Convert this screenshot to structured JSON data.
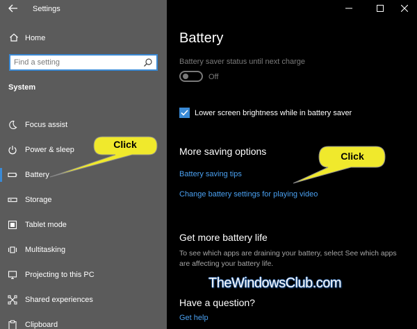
{
  "window": {
    "app_title": "Settings",
    "controls": {
      "minimize": "—",
      "maximize": "☐",
      "close": "✕"
    }
  },
  "sidebar": {
    "home_label": "Home",
    "search": {
      "placeholder": "Find a setting",
      "value": ""
    },
    "section_label": "System",
    "items": [
      {
        "label": "Focus assist",
        "icon": "moon-icon"
      },
      {
        "label": "Power & sleep",
        "icon": "power-icon"
      },
      {
        "label": "Battery",
        "icon": "battery-icon",
        "selected": true
      },
      {
        "label": "Storage",
        "icon": "storage-icon"
      },
      {
        "label": "Tablet mode",
        "icon": "tablet-mode-icon"
      },
      {
        "label": "Multitasking",
        "icon": "multitasking-icon"
      },
      {
        "label": "Projecting to this PC",
        "icon": "projecting-icon"
      },
      {
        "label": "Shared experiences",
        "icon": "shared-experiences-icon"
      },
      {
        "label": "Clipboard",
        "icon": "clipboard-icon"
      }
    ]
  },
  "main": {
    "title": "Battery",
    "saver_status_label": "Battery saver status until next charge",
    "toggle": {
      "state_label": "Off",
      "on": false
    },
    "checkbox": {
      "label": "Lower screen brightness while in battery saver",
      "checked": true
    },
    "more_saving": {
      "heading": "More saving options",
      "links": [
        "Battery saving tips",
        "Change battery settings for playing video"
      ]
    },
    "more_life": {
      "heading": "Get more battery life",
      "text": "To see which apps are draining your battery, select See which apps are affecting your battery life."
    },
    "question": {
      "heading": "Have a question?",
      "link": "Get help"
    }
  },
  "callouts": {
    "sidebar_text": "Click",
    "main_text": "Click"
  },
  "watermark": "TheWindowsClub.com",
  "colors": {
    "accent": "#3a8ad6",
    "link": "#4aa0f0",
    "callout": "#f0e92c",
    "sidebar_bg": "#5b5b5b",
    "main_bg": "#000000"
  }
}
